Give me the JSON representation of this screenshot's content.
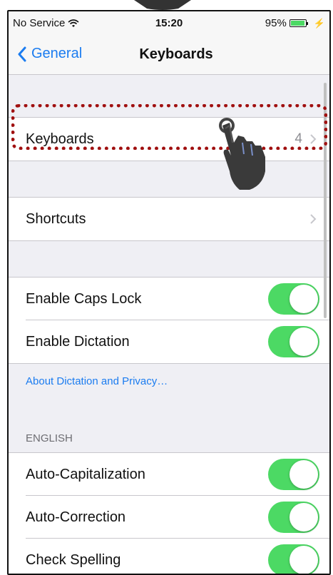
{
  "status_bar": {
    "carrier": "No Service",
    "time": "15:20",
    "battery_percent": "95%",
    "battery_level": 0.95
  },
  "nav": {
    "back_label": "General",
    "title": "Keyboards"
  },
  "rows": {
    "keyboards": {
      "label": "Keyboards",
      "detail": "4"
    },
    "shortcuts": {
      "label": "Shortcuts"
    },
    "caps_lock": {
      "label": "Enable Caps Lock",
      "on": true
    },
    "dictation": {
      "label": "Enable Dictation",
      "on": true
    },
    "dictation_link": "About Dictation and Privacy…",
    "english_header": "ENGLISH",
    "auto_cap": {
      "label": "Auto-Capitalization",
      "on": true
    },
    "auto_correct": {
      "label": "Auto-Correction",
      "on": true
    },
    "check_spelling": {
      "label": "Check Spelling",
      "on": true
    }
  },
  "colors": {
    "accent": "#1b7cf0",
    "toggle_on": "#4cd964",
    "highlight": "#a01010",
    "background": "#efeff4"
  },
  "icons": [
    "wifi-icon",
    "battery-icon",
    "charge-icon",
    "back-chevron-icon",
    "chevron-right-icon",
    "pointing-hand-icon"
  ]
}
